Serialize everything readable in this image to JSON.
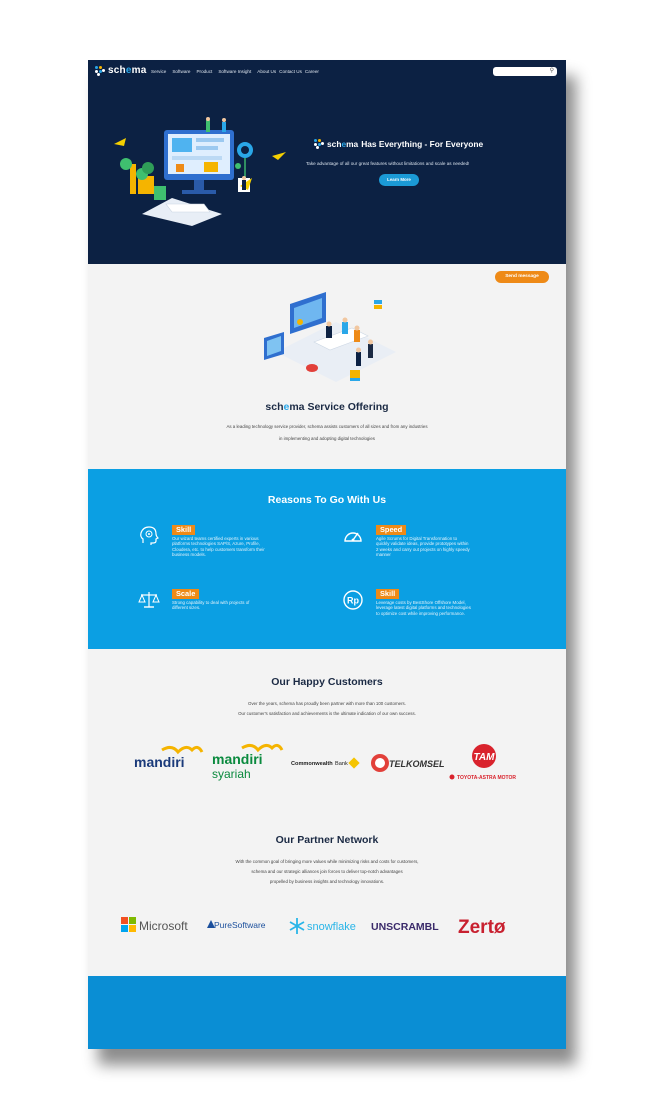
{
  "brand": {
    "name_pre": "sch",
    "name_mid": "e",
    "name_post": "ma"
  },
  "nav": {
    "items": [
      "Service",
      "Software",
      "Product",
      "Software Insight",
      "About Us",
      "Contact Us",
      "Career"
    ],
    "search_placeholder": ""
  },
  "hero": {
    "title": "Has Everything - For Everyone",
    "subtitle": "Take advantage of all our great features without limitations and scale as needed!",
    "button": "Learn More"
  },
  "service": {
    "send_message": "Send message",
    "title": "Service Offering",
    "desc_line1": "As a leading technology service provider, schema assists customers of all sizes and from any industries",
    "desc_line2": "in implementing and adopting digital technologies"
  },
  "reasons": {
    "title": "Reasons To Go With Us",
    "items": [
      {
        "label": "Skill",
        "icon": "brain-head-icon",
        "lines": [
          "Our wizard teams certified experts in various",
          "platforms technologies SAP/S, Azure, Profile,",
          "Cloudera, etc. to help customers transform their",
          "business models."
        ]
      },
      {
        "label": "Speed",
        "icon": "speedometer-icon",
        "lines": [
          "Agile Scrums for Digital Transformation to",
          "quickly validate ideas, provide prototypes within",
          "2 weeks and carry out projects on highly speedy",
          "manner"
        ]
      },
      {
        "label": "Scale",
        "icon": "balance-scale-icon",
        "lines": [
          "Strong capability to deal with projects of",
          "different sizes."
        ]
      },
      {
        "label": "Skill",
        "icon": "rupiah-coin-icon",
        "lines": [
          "Leverage costs by BestShore Offshore Model,",
          "leverage latest digital platforms and technologies",
          "to optimize cost while improving performance."
        ]
      }
    ]
  },
  "customers": {
    "title": "Our Happy Customers",
    "line1": "Over the years, schema has proudly been partner with more than 100 customers.",
    "line2": "Our customer's satisfaction and achievements is the ultimate indication of our own success.",
    "logos": {
      "mandiri": "mandiri",
      "mandiri_syariah_1": "mandiri",
      "mandiri_syariah_2": "syariah",
      "commonwealth_1": "Commonwealth",
      "commonwealth_2": "Bank",
      "telkomsel": "TELKOMSEL",
      "tam_mark": "TAM",
      "tam_text": "TOYOTA-ASTRA MOTOR"
    }
  },
  "partners": {
    "title": "Our Partner Network",
    "line1": "With the common goal of bringing more values while minimizing risks and costs for customers,",
    "line2": "schema and our strategic alliances join forces to deliver top-notch advantages",
    "line3": "propelled by business insights and technology innovations.",
    "logos": {
      "microsoft": "Microsoft",
      "puresoftware": "PureSoftware",
      "snowflake": "snowflake",
      "unscrambl": "UNSCRAMBL",
      "zerto": "Zertø"
    }
  },
  "colors": {
    "navy": "#0c2143",
    "accent_blue": "#0b9fe3",
    "orange": "#ee8a17",
    "footer": "#0a8ed4"
  }
}
